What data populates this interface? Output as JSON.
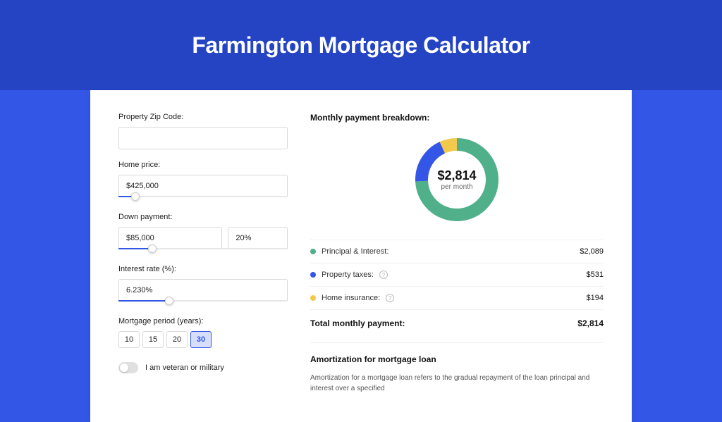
{
  "header": {
    "title": "Farmington Mortgage Calculator"
  },
  "form": {
    "zip": {
      "label": "Property Zip Code:",
      "value": ""
    },
    "home_price": {
      "label": "Home price:",
      "value": "$425,000",
      "slider_pct": 10
    },
    "down_payment": {
      "label": "Down payment:",
      "amount": "$85,000",
      "percent": "20%",
      "slider_pct": 20
    },
    "interest_rate": {
      "label": "Interest rate (%):",
      "value": "6.230%",
      "slider_pct": 30
    },
    "period": {
      "label": "Mortgage period (years):",
      "options": [
        "10",
        "15",
        "20",
        "30"
      ],
      "active": "30"
    },
    "veteran": {
      "label": "I am veteran or military",
      "on": false
    }
  },
  "breakdown": {
    "title": "Monthly payment breakdown:",
    "total_value": "$2,814",
    "total_sub": "per month",
    "items": [
      {
        "label": "Principal & Interest:",
        "value": "$2,089",
        "color": "#4fb08a",
        "info": false
      },
      {
        "label": "Property taxes:",
        "value": "$531",
        "color": "#3356e6",
        "info": true
      },
      {
        "label": "Home insurance:",
        "value": "$194",
        "color": "#f2c94c",
        "info": true
      }
    ],
    "total_row": {
      "label": "Total monthly payment:",
      "value": "$2,814"
    }
  },
  "chart_data": {
    "type": "pie",
    "title": "Monthly payment breakdown",
    "series": [
      {
        "name": "Principal & Interest",
        "value": 2089,
        "color": "#4fb08a"
      },
      {
        "name": "Property taxes",
        "value": 531,
        "color": "#3356e6"
      },
      {
        "name": "Home insurance",
        "value": 194,
        "color": "#f2c94c"
      }
    ],
    "total": 2814,
    "center_label": "$2,814",
    "center_sub": "per month"
  },
  "amortization": {
    "title": "Amortization for mortgage loan",
    "text": "Amortization for a mortgage loan refers to the gradual repayment of the loan principal and interest over a specified"
  }
}
